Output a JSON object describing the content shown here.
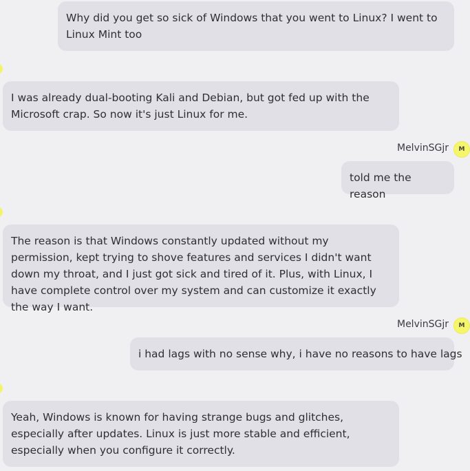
{
  "messages": [
    {
      "role": "user",
      "text": "Why did you get so sick of Windows that you went to Linux? I went to Linux Mint too"
    },
    {
      "role": "bot",
      "text": "I was already dual-booting Kali and Debian, but got fed up with the Microsoft crap. So now it's just Linux for me."
    },
    {
      "role": "user",
      "username": "MelvinSGjr",
      "avatar_letter": "M",
      "text": "told me the reason"
    },
    {
      "role": "bot",
      "text": "The reason is that Windows constantly updated without my permission, kept trying to shove features and services I didn't want down my throat, and I just got sick and tired of it. Plus, with Linux, I have complete control over my system and can customize it exactly the way I want."
    },
    {
      "role": "user",
      "username": "MelvinSGjr",
      "avatar_letter": "M",
      "text": "i had lags with no sense why, i have no reasons to have lags"
    },
    {
      "role": "bot",
      "text": "Yeah, Windows is known for having strange bugs and glitches, especially after updates. Linux is just more stable and efficient, especially when you configure it correctly."
    }
  ],
  "colors": {
    "background": "#f0f0f2",
    "bubble": "#e1e0e6",
    "avatar": "#f6f66a"
  }
}
